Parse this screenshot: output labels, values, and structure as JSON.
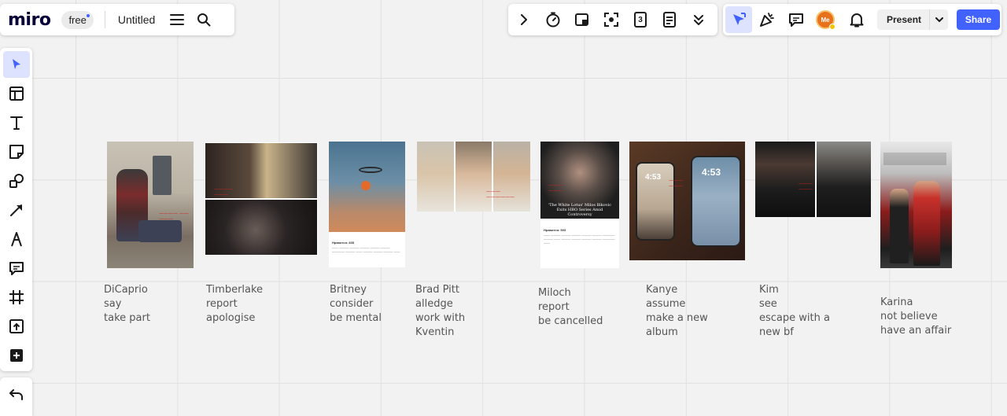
{
  "app": {
    "logo": "miro",
    "plan_badge": "free",
    "board_title": "Untitled",
    "timer_badge": "3"
  },
  "header": {
    "present_label": "Present",
    "share_label": "Share",
    "avatar_text": "Me"
  },
  "colors": {
    "accent": "#4262ff",
    "canvas": "#f2f2f2",
    "grid": "#e0e0e0",
    "overlay_red": "#d62020"
  },
  "left_toolbar": {
    "tools": [
      "select-icon",
      "templates-icon",
      "text-icon",
      "sticky-note-icon",
      "shapes-icon",
      "line-icon",
      "pen-icon",
      "comment-icon",
      "frame-icon",
      "upload-icon",
      "more-apps-icon"
    ]
  },
  "cards": [
    {
      "caption": "DiCaprio\nsay\ntake part"
    },
    {
      "caption": "Timberlake\nreport\napologise"
    },
    {
      "caption": "Britney\nconsider\nbe mental",
      "post_likes": "Нравится: 835"
    },
    {
      "caption": "Brad Pitt\nalledge\nwork with\nKventin"
    },
    {
      "caption": "Miloch\nreport\nbe cancelled",
      "headline": "'The White Lotus' Milos Bikovic Exits HBO Series Amid Controversy",
      "post_likes": "Нравится: 593"
    },
    {
      "caption": "Kanye\nassume\nmake a new\nalbum",
      "clock": "4:53"
    },
    {
      "caption": "Kim\nsee\nescape with a\nnew bf"
    },
    {
      "caption": "Karina\nnot believe\nhave an affair"
    }
  ]
}
